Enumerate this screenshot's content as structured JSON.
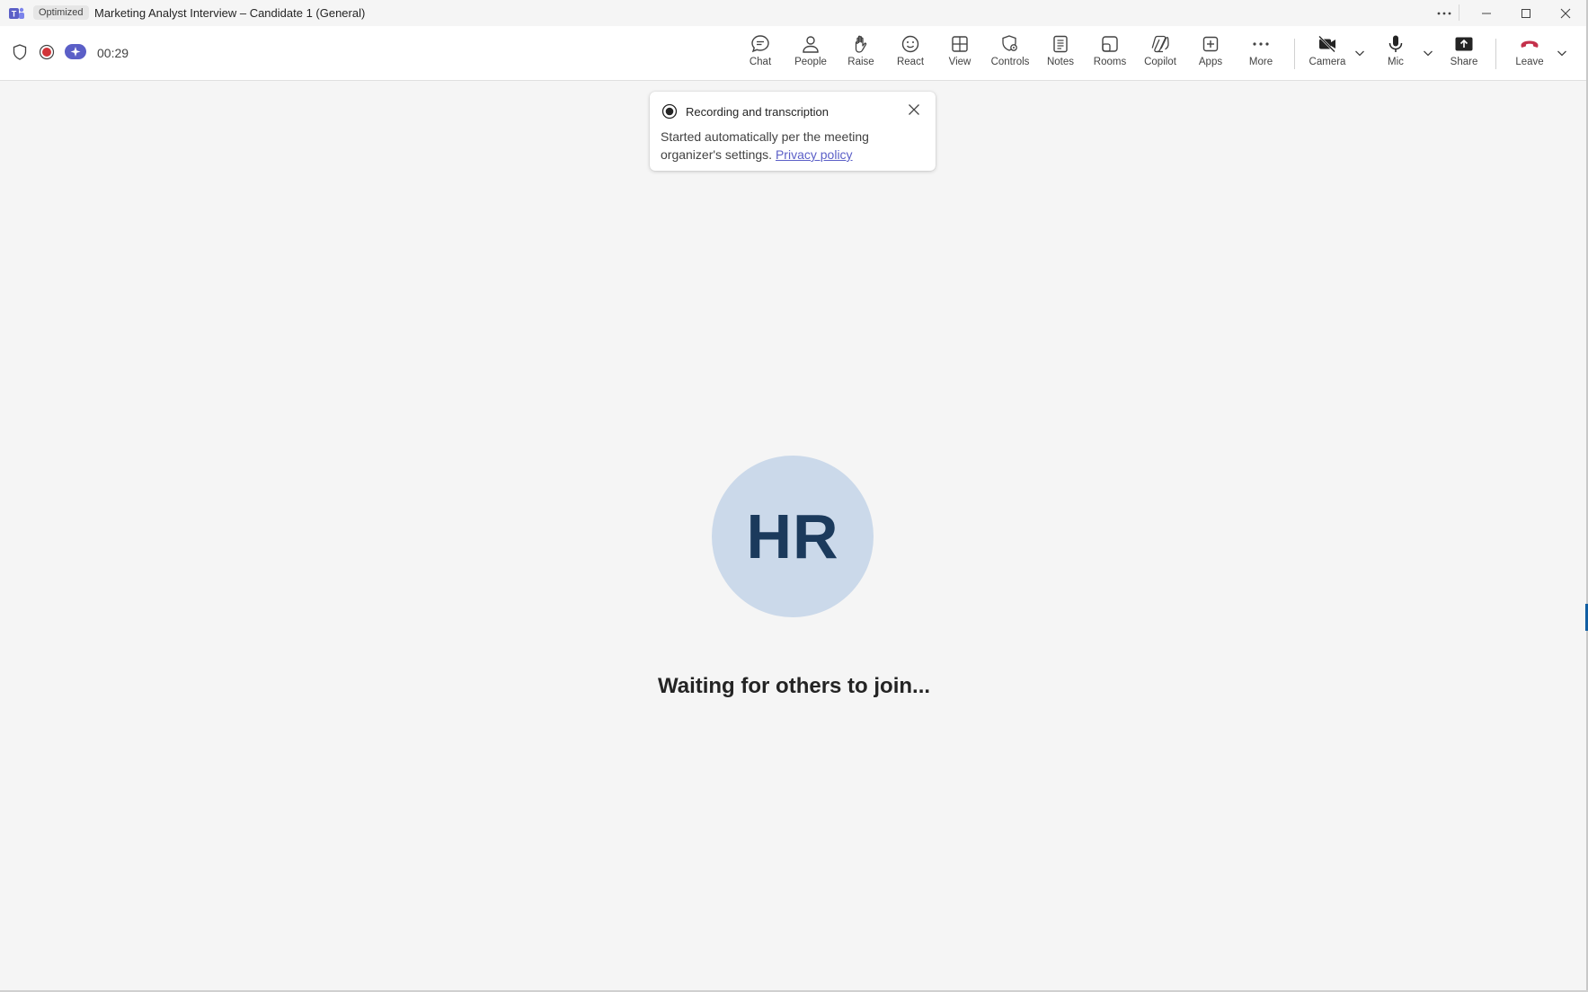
{
  "window": {
    "badge": "Optimized",
    "title": "Marketing Analyst Interview – Candidate 1 (General)"
  },
  "status": {
    "timer": "00:29"
  },
  "toolbar": {
    "chat": "Chat",
    "people": "People",
    "raise": "Raise",
    "react": "React",
    "view": "View",
    "controls": "Controls",
    "notes": "Notes",
    "rooms": "Rooms",
    "copilot": "Copilot",
    "apps": "Apps",
    "more": "More",
    "camera": "Camera",
    "mic": "Mic",
    "share": "Share",
    "leave": "Leave"
  },
  "toast": {
    "title": "Recording and transcription",
    "body": "Started automatically per the meeting organizer's settings.",
    "link": "Privacy policy"
  },
  "stage": {
    "initials": "HR",
    "message": "Waiting for others to join..."
  },
  "colors": {
    "accent": "#5b5fc7",
    "record": "#d13438",
    "leave": "#c4314b",
    "avatar_bg": "#cbd9ea",
    "avatar_text": "#1b3a5c"
  }
}
